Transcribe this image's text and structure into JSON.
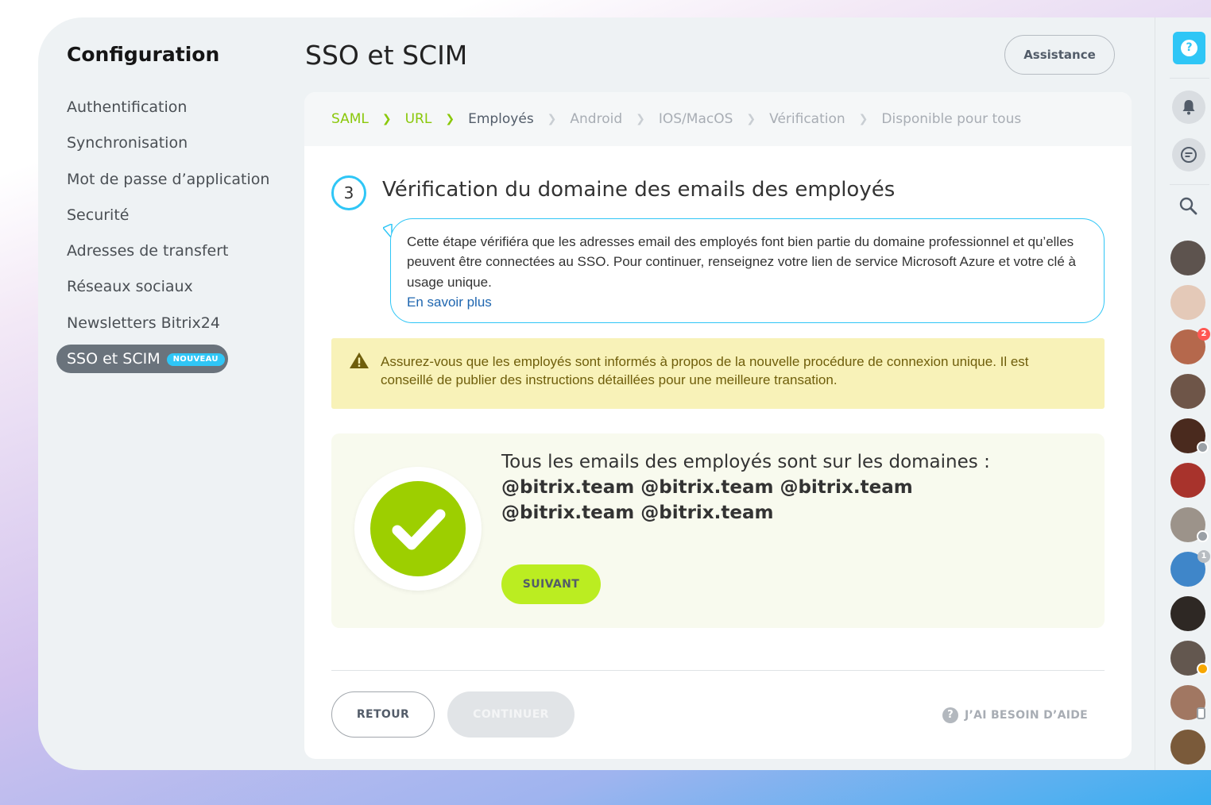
{
  "sidebar": {
    "title": "Configuration",
    "items": [
      {
        "label": "Authentification"
      },
      {
        "label": "Synchronisation"
      },
      {
        "label": "Mot de passe d’application"
      },
      {
        "label": "Securité"
      },
      {
        "label": "Adresses de transfert"
      },
      {
        "label": "Réseaux sociaux"
      },
      {
        "label": "Newsletters Bitrix24"
      },
      {
        "label": "SSO et SCIM",
        "badge": "NOUVEAU",
        "active": true
      }
    ]
  },
  "header": {
    "title": "SSO et SCIM",
    "assist_label": "Assistance"
  },
  "steps": [
    {
      "label": "SAML",
      "state": "done"
    },
    {
      "label": "URL",
      "state": "done"
    },
    {
      "label": "Employés",
      "state": "current"
    },
    {
      "label": "Android",
      "state": "pending"
    },
    {
      "label": "IOS/MacOS",
      "state": "pending"
    },
    {
      "label": "Vérification",
      "state": "pending"
    },
    {
      "label": "Disponible pour tous",
      "state": "pending"
    }
  ],
  "section": {
    "number": "3",
    "title": "Vérification du domaine des emails des employés"
  },
  "info": {
    "text": "Cette étape vérifiéra que les adresses email des employés font bien partie du domaine professionnel et qu’elles peuvent être connectées au SSO. Pour continuer, renseignez votre lien de service Microsoft Azure et votre clé à usage unique.",
    "link": "En savoir plus"
  },
  "warning": {
    "text": "Assurez-vous que les employés sont informés à propos de la nouvelle procédure de connexion unique. Il est conseillé de publier des instructions détaillées pour une meilleure transation."
  },
  "success": {
    "text": "Tous les emails des employés sont sur les domaines :",
    "domains": "@bitrix.team @bitrix.team @bitrix.team @bitrix.team @bitrix.team",
    "next_label": "SUIVANT"
  },
  "footer": {
    "back_label": "RETOUR",
    "continue_label": "CONTINUER",
    "help_label": "J’AI BESOIN D’AIDE",
    "help_icon": "?"
  },
  "toolbar": {
    "help_icon": "?",
    "avatars": [
      {
        "color": "#5d534e"
      },
      {
        "color": "#e4c9b8"
      },
      {
        "color": "#b5684c",
        "counter": "2"
      },
      {
        "color": "#6e5548"
      },
      {
        "color": "#4a2a1e"
      },
      {
        "color": "#a8332c"
      },
      {
        "color": "#9c938a"
      },
      {
        "color": "#3f86c9",
        "counter": "1"
      },
      {
        "color": "#2e2824"
      },
      {
        "color": "#63574f"
      },
      {
        "color": "#a17762"
      },
      {
        "color": "#7a5a3a"
      }
    ]
  },
  "colors": {
    "accent": "#2fc6f6",
    "success": "#9dcf00",
    "next_button": "#bbed21",
    "warning_bg": "#f8f2b8",
    "step_done": "#8ac80a"
  }
}
